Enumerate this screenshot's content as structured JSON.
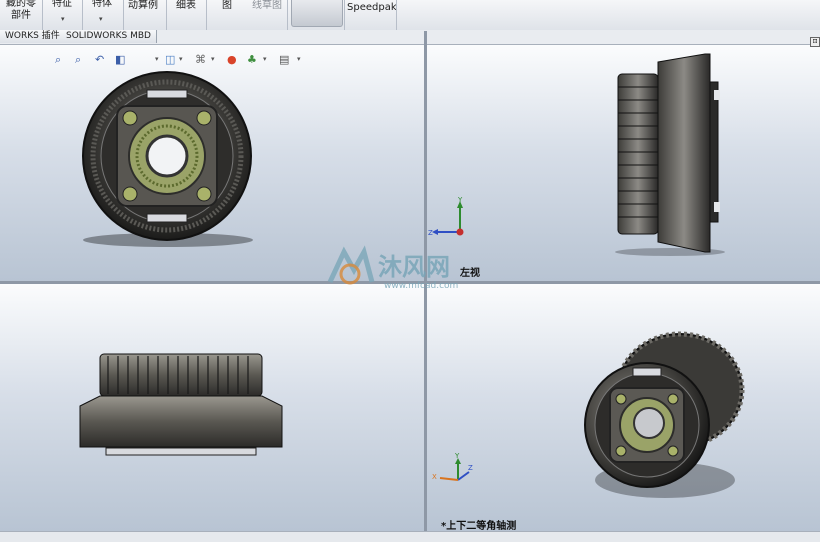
{
  "ribbon": {
    "btn1_line1": "藏的零",
    "btn1_line2": "部件",
    "btn2": "特征",
    "btn3": "特体",
    "btn4": "动算例",
    "btn5": "细表",
    "btn6": "图",
    "btn7": "线草图",
    "btn8": "Speedpak"
  },
  "tabs": [
    "WORKS 插件",
    "SOLIDWORKS MBD"
  ],
  "hud_icons": [
    "zoom-to-fit-icon",
    "zoom-area-icon",
    "previous-view-icon",
    "section-view-icon",
    "view-orientation-icon",
    "display-style-icon",
    "appearance-icon",
    "scene-icon",
    "view-settings-icon"
  ],
  "viewports": {
    "top_right_label": "左视",
    "bottom_right_label": "*上下二等角轴测"
  },
  "watermark": {
    "text": "沐风网",
    "url": "www.mfcad.com"
  },
  "colors": {
    "viewport_top": "#fbfcfd",
    "viewport_bottom": "#b8c4d3",
    "part_dark": "#2a2a2a",
    "part_mid": "#6b6860",
    "accent_green": "#9db25a",
    "watermark": "#7aa6b8"
  }
}
